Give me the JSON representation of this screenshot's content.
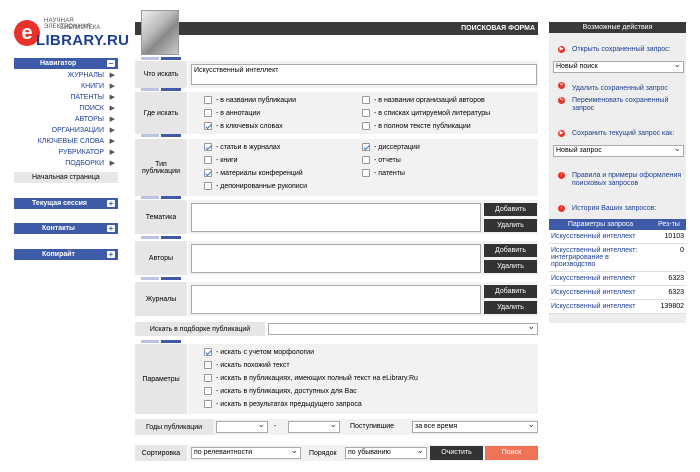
{
  "logo": {
    "line1": "НАУЧНАЯ ЭЛЕКТРОННАЯ",
    "line2": "БИБЛИОТЕКА",
    "brand": "LIBRARY.RU",
    "e": "e"
  },
  "nav": {
    "title": "Навигатор",
    "items": [
      "ЖУРНАЛЫ",
      "КНИГИ",
      "ПАТЕНТЫ",
      "ПОИСК",
      "АВТОРЫ",
      "ОРГАНИЗАЦИИ",
      "КЛЮЧЕВЫЕ СЛОВА",
      "РУБРИКАТОР",
      "ПОДБОРКИ"
    ],
    "home": "Начальная страница"
  },
  "panels": [
    "Текущая сессия",
    "Контакты",
    "Копирайт"
  ],
  "form": {
    "title": "ПОИСКОВАЯ ФОРМА",
    "what_label": "Что искать",
    "what_value": "Искусственный интеллект",
    "where_label": "Где искать",
    "where_opts": [
      "- в названии публикации",
      "- в аннотации",
      "- в ключевых словах",
      "- в названии организаций авторов",
      "- в списках цитируемой литературы",
      "- в полном тексте публикации"
    ],
    "type_label": "Тип публикации",
    "type_opts": [
      "- статьи в журналах",
      "- книги",
      "- материалы конференций",
      "- депонированные рукописи",
      "- диссертации",
      "- отчеты",
      "- патенты"
    ],
    "theme_label": "Тематика",
    "authors_label": "Авторы",
    "journals_label": "Журналы",
    "add": "Добавить",
    "remove": "Удалить",
    "collection_label": "Искать в подборке публикаций",
    "params_label": "Параметры",
    "params_opts": [
      "- искать с учетом морфологии",
      "- искать похожий текст",
      "- искать в публикациях, имеющих полный текст на eLibrary.Ru",
      "- искать в публикациях, доступных для Вас",
      "- искать в результатах предыдущего запроса"
    ],
    "years_label": "Годы публикации",
    "dash": "-",
    "received_label": "Поступившие",
    "received_value": "за все время",
    "sort_label": "Сортировка",
    "sort_value": "по релевантности",
    "order_label": "Порядок",
    "order_value": "по убыванию",
    "clear": "Очистить",
    "search": "Поиск"
  },
  "right": {
    "title": "Возможные действия",
    "open_saved": "Открыть сохраненный запрос:",
    "new_search": "Новый поиск",
    "delete_saved": "Удалить сохраненный запрос",
    "rename_saved": "Переименовать сохраненный запрос",
    "save_current": "Сохранить текущий запрос как:",
    "new_query": "Новый запрос",
    "rules": "Правила и примеры оформления поисковых запросов",
    "history": "История Ваших запросов:",
    "table_h1": "Параметры запроса",
    "table_h2": "Рез-ты",
    "rows": [
      [
        "Искусственный интеллект",
        "10103"
      ],
      [
        "Искусственный интеллект: интегрирование в производство",
        "0"
      ],
      [
        "Искусственный интеллект",
        "6323"
      ],
      [
        "Искусственный интеллект",
        "6323"
      ],
      [
        "Искусственный интеллект",
        "139802"
      ]
    ]
  }
}
